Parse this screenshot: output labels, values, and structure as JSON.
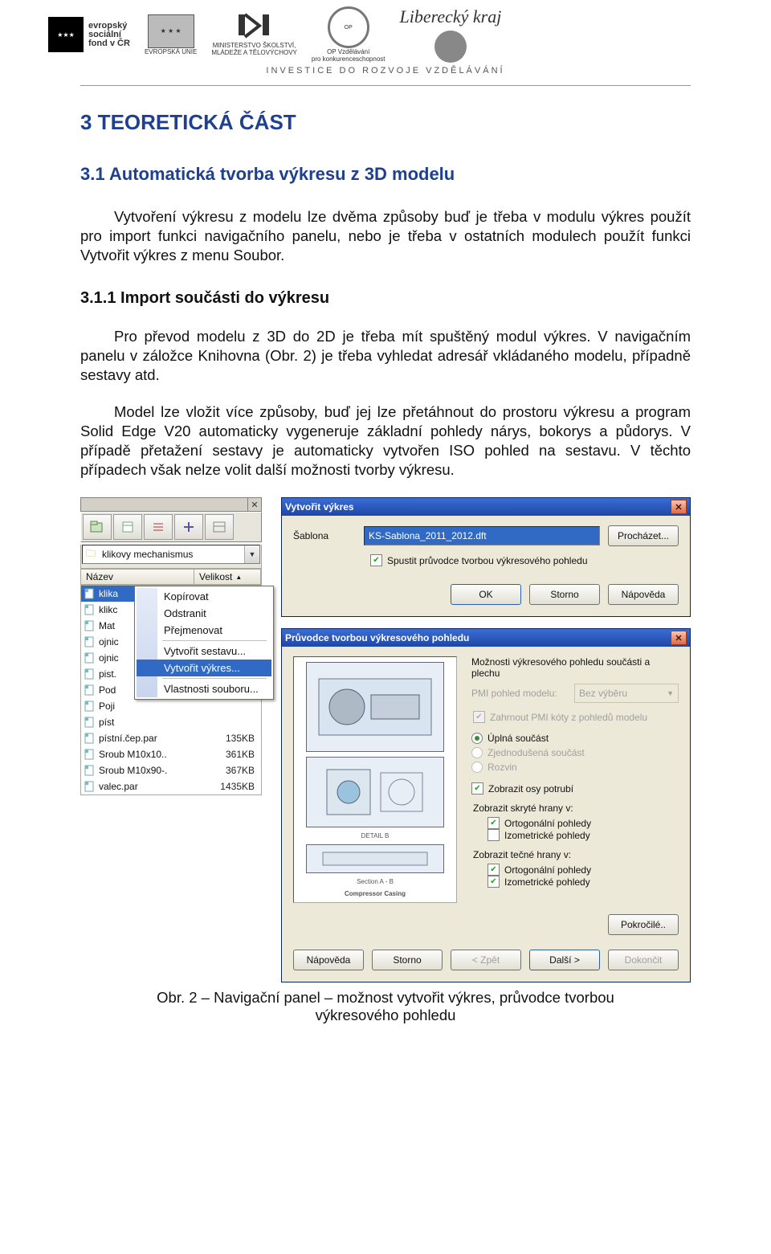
{
  "header": {
    "esf_label1": "evropský",
    "esf_label2": "sociální",
    "esf_label3": "fond v ČR",
    "eu_label": "EVROPSKÁ UNIE",
    "msmt_label1": "MINISTERSTVO ŠKOLSTVÍ,",
    "msmt_label2": "MLÁDEŽE A TĚLOVÝCHOVY",
    "op_label1": "OP Vzdělávání",
    "op_label2": "pro konkurenceschopnost",
    "kraj_label": "Liberecký kraj",
    "subtitle": "INVESTICE  DO  ROZVOJE  VZDĚLÁVÁNÍ"
  },
  "sec1_title": "3  TEORETICKÁ ČÁST",
  "sec11_title": "3.1  Automatická tvorba výkresu z 3D modelu",
  "p1": "Vytvoření výkresu z modelu lze dvěma způsoby buď je třeba v modulu výkres použít pro import funkci navigačního panelu, nebo je třeba v ostatních modulech použít funkci Vytvořit výkres z menu Soubor.",
  "h311_title": "3.1.1 Import součásti do výkresu",
  "p2": "Pro převod modelu z 3D do 2D je třeba mít spuštěný modul výkres. V navigačním panelu v záložce Knihovna (Obr. 2) je třeba vyhledat adresář vkládaného modelu, případně sestavy atd.",
  "p3": "Model lze vložit více způsoby, buď jej lze přetáhnout do prostoru výkresu a program Solid Edge V20 automaticky vygeneruje základní pohledy nárys, bokorys a půdorys. V případě přetažení sestavy je automaticky vytvořen ISO pohled na sestavu. V těchto případech však nelze volit další možnosti tvorby výkresu.",
  "nav": {
    "folder": "klikovy mechanismus",
    "col_name": "Název",
    "col_size": "Velikost",
    "files": [
      {
        "n": "klika",
        "s": ""
      },
      {
        "n": "klikc",
        "s": ""
      },
      {
        "n": "Mat",
        "s": ""
      },
      {
        "n": "ojnic",
        "s": ""
      },
      {
        "n": "ojnic",
        "s": ""
      },
      {
        "n": "pist.",
        "s": ""
      },
      {
        "n": "Pod",
        "s": ""
      },
      {
        "n": "Poji",
        "s": ""
      },
      {
        "n": "píst",
        "s": ""
      },
      {
        "n": "pístní.čep.par",
        "s": "135KB"
      },
      {
        "n": "Sroub M10x10..",
        "s": "361KB"
      },
      {
        "n": "Sroub M10x90-.",
        "s": "367KB"
      },
      {
        "n": "valec.par",
        "s": "1435KB"
      }
    ],
    "ctx": {
      "copy": "Kopírovat",
      "delete": "Odstranit",
      "rename": "Přejmenovat",
      "create_asm": "Vytvořit sestavu...",
      "create_dft": "Vytvořit výkres...",
      "props": "Vlastnosti souboru..."
    }
  },
  "dlg1": {
    "title": "Vytvořit výkres",
    "tpl_label": "Šablona",
    "tpl_value": "KS-Sablona_2011_2012.dft",
    "browse": "Procházet...",
    "chk_wizard": "Spustit průvodce tvorbou výkresového pohledu",
    "ok": "OK",
    "cancel": "Storno",
    "help": "Nápověda"
  },
  "dlg2": {
    "title": "Průvodce tvorbou výkresového pohledu",
    "grp1": "Možnosti výkresového pohledu součásti a plechu",
    "pmi_lbl": "PMI pohled modelu:",
    "pmi_val": "Bez výběru",
    "pmi_chk": "Zahrnout PMI kóty z pohledů modelu",
    "r_full": "Úplná součást",
    "r_simpl": "Zjednodušená součást",
    "r_flat": "Rozvin",
    "chk_axes": "Zobrazit osy potrubí",
    "grp_hidden": "Zobrazit skryté hrany v:",
    "grp_tangent": "Zobrazit tečné hrany v:",
    "ortho": "Ortogonální pohledy",
    "iso": "Izometrické pohledy",
    "adv": "Pokročilé..",
    "help": "Nápověda",
    "cancel": "Storno",
    "back": "< Zpět",
    "next": "Další >",
    "finish": "Dokončit",
    "prev_d": "DETAIL B",
    "prev_s": "Section A - B",
    "prev_c": "Compressor Casing"
  },
  "fig_caption": "Obr. 2 – Navigační panel – možnost vytvořit výkres, průvodce tvorbou výkresového pohledu"
}
